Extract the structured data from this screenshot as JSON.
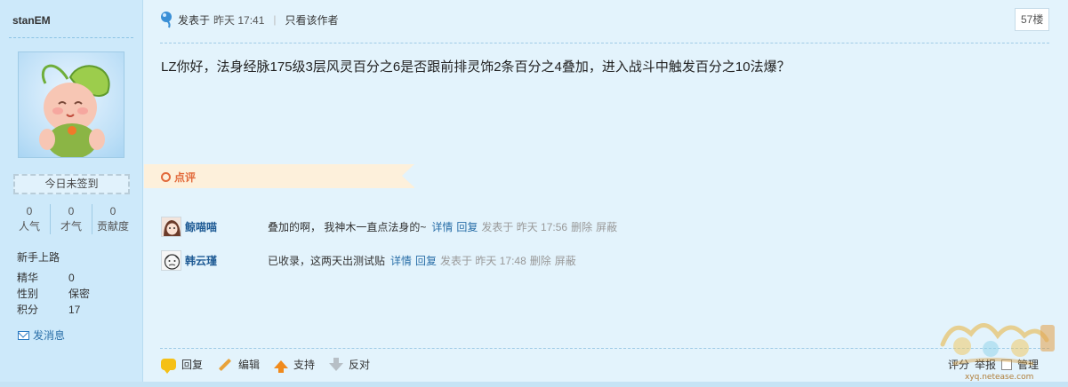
{
  "user": {
    "name": "stanEM",
    "signin_label": "今日未签到",
    "stats": [
      {
        "value": "0",
        "label": "人气"
      },
      {
        "value": "0",
        "label": "才气"
      },
      {
        "value": "0",
        "label": "贡献度"
      }
    ],
    "rank": "新手上路",
    "info": [
      {
        "key": "精华",
        "value": "0"
      },
      {
        "key": "性别",
        "value": "保密"
      },
      {
        "key": "积分",
        "value": "17"
      }
    ],
    "pm_label": "发消息"
  },
  "post": {
    "posted_prefix": "发表于",
    "posted_time": "昨天 17:41",
    "only_author": "只看该作者",
    "floor": "57楼",
    "content": "LZ你好，法身经脉175级3层风灵百分之6是否跟前排灵饰2条百分之4叠加，进入战斗中触发百分之10法爆？"
  },
  "comments": {
    "label": "点评",
    "items": [
      {
        "name": "鲸喵喵",
        "text": "叠加的啊， 我神木一直点法身的~",
        "detail": "详情",
        "reply": "回复",
        "meta": "发表于 昨天 17:56",
        "delete": "删除",
        "block": "屏蔽"
      },
      {
        "name": "韩云瑾",
        "text": "已收录，这两天出测试贴",
        "detail": "详情",
        "reply": "回复",
        "meta": "发表于 昨天 17:48",
        "delete": "删除",
        "block": "屏蔽"
      }
    ]
  },
  "actions": {
    "reply": "回复",
    "edit": "编辑",
    "support": "支持",
    "oppose": "反对",
    "rate": "评分",
    "report": "举报",
    "manage": "管理"
  },
  "watermark": {
    "site": "xyq.netease.com"
  },
  "colors": {
    "sidebar_bg": "#cde9fa",
    "main_bg": "#e3f3fc",
    "link": "#2a6fa8",
    "comment_accent": "#e26a3b"
  }
}
